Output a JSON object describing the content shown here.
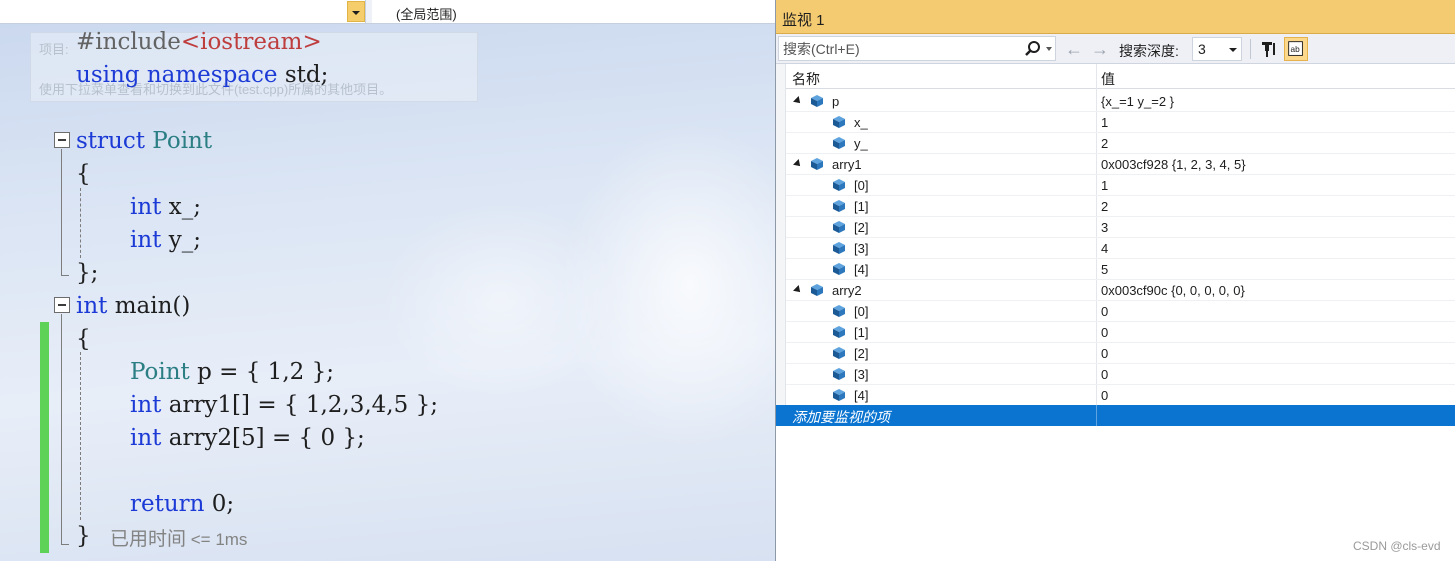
{
  "nav": {
    "project_dropdown_value": "",
    "scope_label": "(全局范围)"
  },
  "ghost_tip": {
    "line1": "项目:",
    "line2": "使用下拉菜单查看和切换到此文件(test.cpp)所属的其他项目。"
  },
  "editor": {
    "include_directive": "#include",
    "include_header": "<iostream>",
    "using_kw": "using",
    "namespace_kw": "namespace",
    "std": " std;",
    "struct_kw": "struct",
    "struct_name": "Point",
    "open_brace": "{",
    "int_kw": "int",
    "x_member": " x_;",
    "y_member": " y_;",
    "close_brace_semi": "};",
    "main_int": "int",
    "main_name": " main()",
    "main_open": "{",
    "point_type": "Point",
    "p_decl": " p = { 1,2 };",
    "arry1_decl": " arry1[] = { 1,2,3,4,5 };",
    "arry2_decl": " arry2[5] = { 0 };",
    "return_kw": "return",
    "return_val": " 0;",
    "main_close": "}",
    "perf_tip_label": "已用时间",
    "perf_tip_value": " <= 1ms"
  },
  "watch": {
    "title": "监视 1",
    "search_placeholder": "搜索(Ctrl+E)",
    "depth_label": "搜索深度:",
    "depth_value": "3",
    "col_name": "名称",
    "col_value": "值",
    "rows": [
      {
        "name": "p",
        "value": "{x_=1 y_=2 }"
      },
      {
        "name": "x_",
        "value": "1"
      },
      {
        "name": "y_",
        "value": "2"
      },
      {
        "name": "arry1",
        "value": "0x003cf928 {1, 2, 3, 4, 5}"
      },
      {
        "name": "[0]",
        "value": "1"
      },
      {
        "name": "[1]",
        "value": "2"
      },
      {
        "name": "[2]",
        "value": "3"
      },
      {
        "name": "[3]",
        "value": "4"
      },
      {
        "name": "[4]",
        "value": "5"
      },
      {
        "name": "arry2",
        "value": "0x003cf90c {0, 0, 0, 0, 0}"
      },
      {
        "name": "[0]",
        "value": "0"
      },
      {
        "name": "[1]",
        "value": "0"
      },
      {
        "name": "[2]",
        "value": "0"
      },
      {
        "name": "[3]",
        "value": "0"
      },
      {
        "name": "[4]",
        "value": "0"
      }
    ],
    "add_item_label": "添加要监视的项"
  },
  "watermark": "CSDN @cls-evd",
  "colors": {
    "keyword": "#1c3ad6",
    "type": "#2b7f84",
    "include_string": "#be3e3e",
    "title_bar": "#f5cb72",
    "selection": "#0a74d0",
    "change_bar": "#5ed157"
  },
  "icons": [
    "chevron-down-icon",
    "search-icon",
    "back-arrow-icon",
    "forward-arrow-icon",
    "pin-filter-icon",
    "hex-display-icon",
    "expand-triangle-icon",
    "field-cube-icon"
  ]
}
